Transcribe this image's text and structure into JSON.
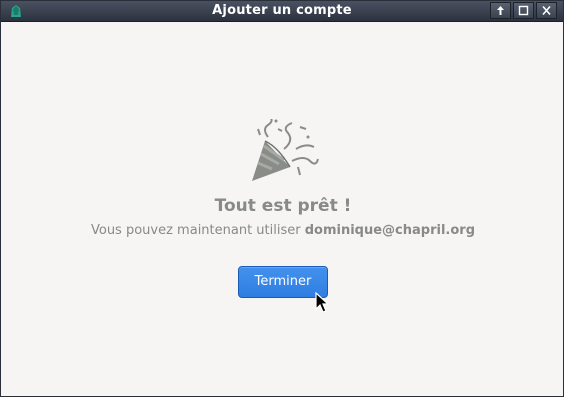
{
  "window": {
    "title": "Ajouter un compte",
    "controls": [
      "arrow-up-icon",
      "maximize-icon",
      "close-icon"
    ]
  },
  "main": {
    "heading": "Tout est prêt !",
    "message_prefix": "Vous pouvez maintenant utiliser ",
    "account": "dominique@chapril.org",
    "finish_label": "Terminer"
  },
  "colors": {
    "accent": "#3584e4",
    "text_muted": "#888a85",
    "titlebar": "#2c323e",
    "background": "#f6f5f4"
  }
}
